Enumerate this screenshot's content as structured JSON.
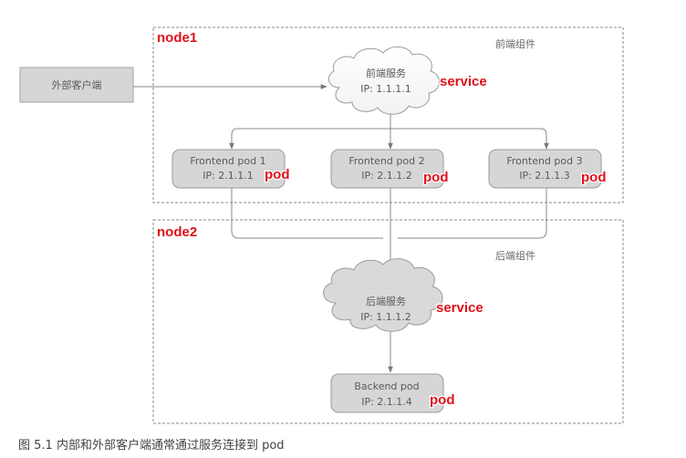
{
  "regions": {
    "frontend_label": "前端组件",
    "backend_label": "后端组件"
  },
  "nodes": {
    "node1": "node1",
    "node2": "node2"
  },
  "external_client": "外部客户端",
  "frontend_service": {
    "name": "前端服务",
    "ip": "IP: 1.1.1.1",
    "tag": "service"
  },
  "frontend_pods": [
    {
      "name": "Frontend pod 1",
      "ip": "IP: 2.1.1.1",
      "tag": "pod"
    },
    {
      "name": "Frontend pod 2",
      "ip": "IP: 2.1.1.2",
      "tag": "pod"
    },
    {
      "name": "Frontend pod 3",
      "ip": "IP: 2.1.1.3",
      "tag": "pod"
    }
  ],
  "backend_service": {
    "name": "后端服务",
    "ip": "IP: 1.1.1.2",
    "tag": "service"
  },
  "backend_pod": {
    "name": "Backend pod",
    "ip": "IP: 2.1.1.4",
    "tag": "pod"
  },
  "caption": "图 5.1   内部和外部客户端通常通过服务连接到 pod",
  "colors": {
    "box_fill": "#d6d6d6",
    "box_stroke": "#9a9a9a",
    "line": "#8a8a8a",
    "annotation": "#e0101a"
  }
}
